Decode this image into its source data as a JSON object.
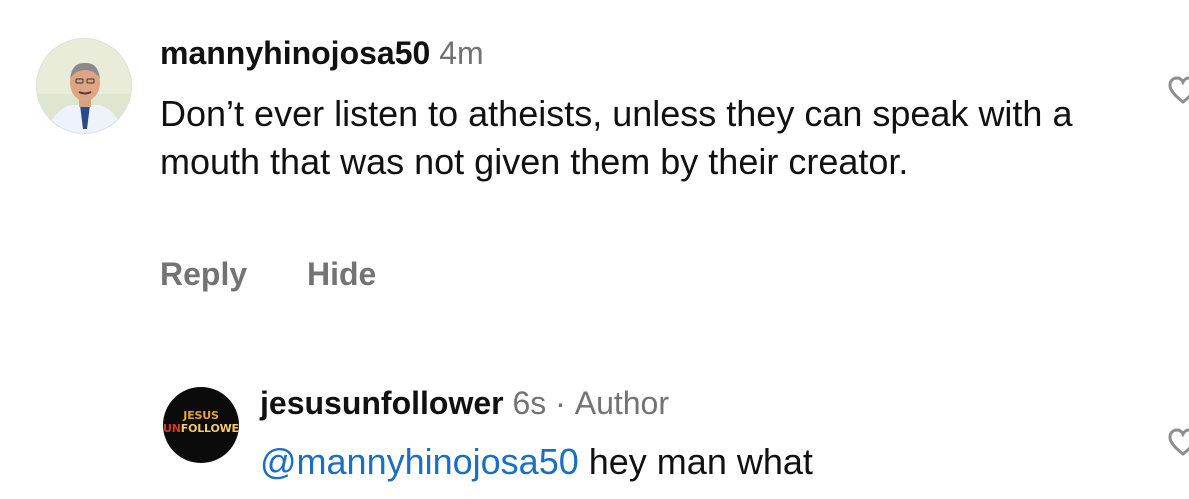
{
  "comments": [
    {
      "username": "mannyhinojosa50",
      "time": "4m",
      "text": "Don’t ever listen to atheists, unless they can speak with a mouth that was not given them by their creator.",
      "actions": {
        "reply": "Reply",
        "hide": "Hide"
      }
    },
    {
      "username": "jesusunfollower",
      "time": "6s",
      "separator": "·",
      "badge": "Author",
      "mention": "@mannyhinojosa50",
      "text": "hey man what",
      "avatar_logo": {
        "line1": "JESUS",
        "line2_a": "UN",
        "line2_b": "FOLLOWER"
      }
    }
  ],
  "colors": {
    "text": "#111111",
    "secondary": "#737373",
    "mention": "#1a6fc4"
  },
  "icons": [
    "heart-icon",
    "heart-icon"
  ]
}
